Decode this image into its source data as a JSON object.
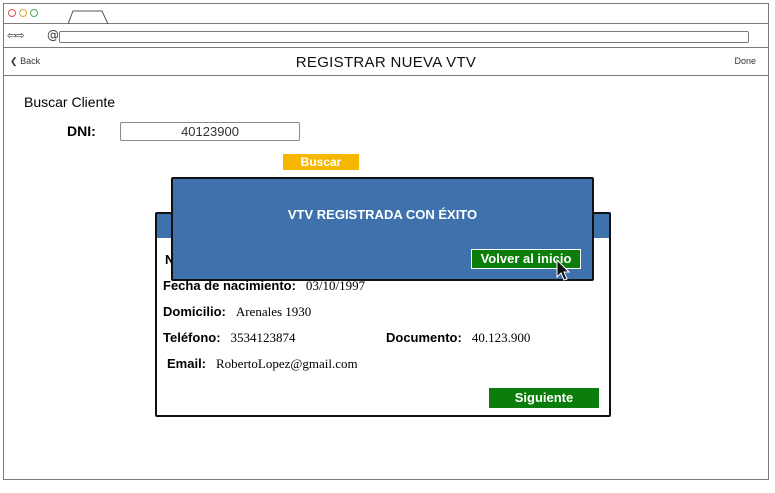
{
  "browser": {
    "address": ""
  },
  "header": {
    "back_label": "Back",
    "title": "REGISTRAR NUEVA VTV",
    "done_label": "Done"
  },
  "search": {
    "section_title": "Buscar Cliente",
    "dni_label": "DNI:",
    "dni_value": "40123900",
    "button_label": "Buscar"
  },
  "client": {
    "fields": {
      "fecha": {
        "label": "Fecha de nacimiento:",
        "value": "03/10/1997"
      },
      "domicilio": {
        "label": "Domicilio:",
        "value": "Arenales 1930"
      },
      "telefono": {
        "label": "Teléfono:",
        "value": "3534123874"
      },
      "documento": {
        "label": "Documento:",
        "value": "40.123.900"
      },
      "email": {
        "label": "Email:",
        "value": "RobertoLopez@gmail.com"
      }
    },
    "partial_label": "N",
    "next_button": "Siguiente"
  },
  "modal": {
    "message": "VTV REGISTRADA CON ÉXITO",
    "button_label": "Volver al inicio"
  },
  "colors": {
    "header_blue": "#3f72ad",
    "primary_green": "#0a7d0a",
    "buscar_yellow": "#f5b700"
  }
}
